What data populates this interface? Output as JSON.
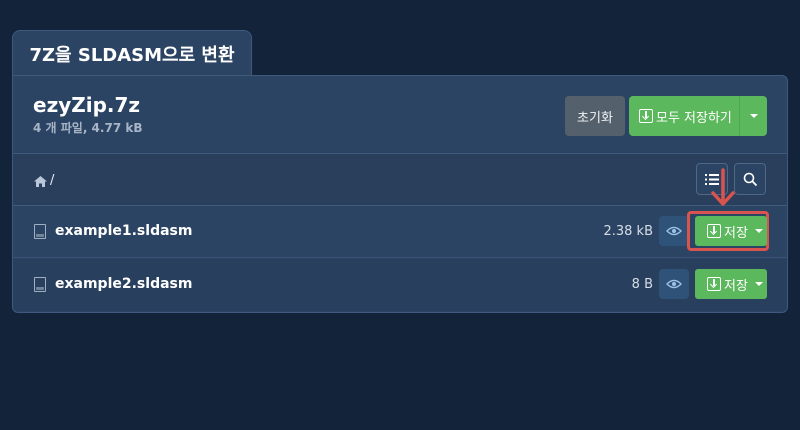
{
  "tab": {
    "title": "7Z을 SLDASM으로 변환"
  },
  "archive": {
    "name": "ezyZip.7z",
    "meta": "4 개 파일, 4.77 kB"
  },
  "buttons": {
    "reset": "초기화",
    "save_all": "모두 저장하기",
    "save": "저장"
  },
  "path": "/",
  "files": [
    {
      "name": "example1.sldasm",
      "size": "2.38 kB"
    },
    {
      "name": "example2.sldasm",
      "size": "8 B"
    }
  ],
  "colors": {
    "accent_green": "#5cb85c",
    "highlight_red": "#d9534f",
    "panel": "#2c4463",
    "background": "#12233a"
  },
  "icons": [
    "home-icon",
    "list-icon",
    "search-icon",
    "file-icon",
    "eye-icon",
    "download-icon",
    "caret-down-icon",
    "arrow-down-icon"
  ]
}
